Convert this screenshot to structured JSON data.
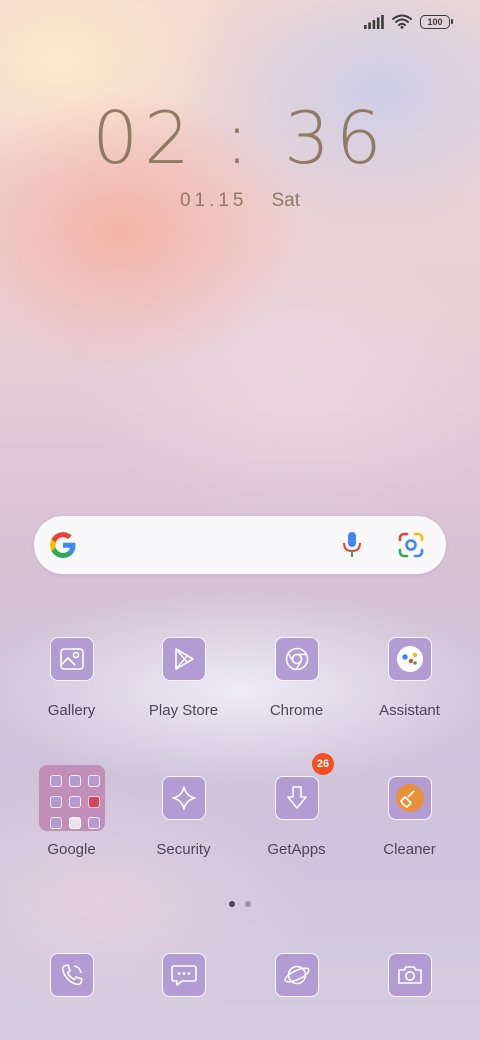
{
  "status_bar": {
    "battery": "100"
  },
  "lockscreen": {
    "time": "02 : 36",
    "date": "01.15",
    "day": "Sat"
  },
  "search": {
    "google_logo": "google-g-icon",
    "mic_icon": "mic-icon",
    "lens_icon": "lens-icon"
  },
  "row1": [
    {
      "label": "Gallery",
      "icon": "gallery-icon"
    },
    {
      "label": "Play Store",
      "icon": "play-store-icon"
    },
    {
      "label": "Chrome",
      "icon": "chrome-icon"
    },
    {
      "label": "Assistant",
      "icon": "assistant-icon"
    }
  ],
  "row2": [
    {
      "label": "Google",
      "icon": "folder"
    },
    {
      "label": "Security",
      "icon": "security-icon"
    },
    {
      "label": "GetApps",
      "icon": "getapps-icon",
      "badge": "26"
    },
    {
      "label": "Cleaner",
      "icon": "cleaner-icon"
    }
  ],
  "dock": [
    {
      "icon": "phone-icon"
    },
    {
      "icon": "messages-icon"
    },
    {
      "icon": "browser-icon"
    },
    {
      "icon": "camera-icon"
    }
  ],
  "page_indicator": {
    "pages": 2,
    "active": 1
  },
  "colors": {
    "icon_bg": "#b39bd3",
    "folder_bg": "#c18eb8",
    "badge": "#f25022",
    "clock": "#8f7a63"
  }
}
